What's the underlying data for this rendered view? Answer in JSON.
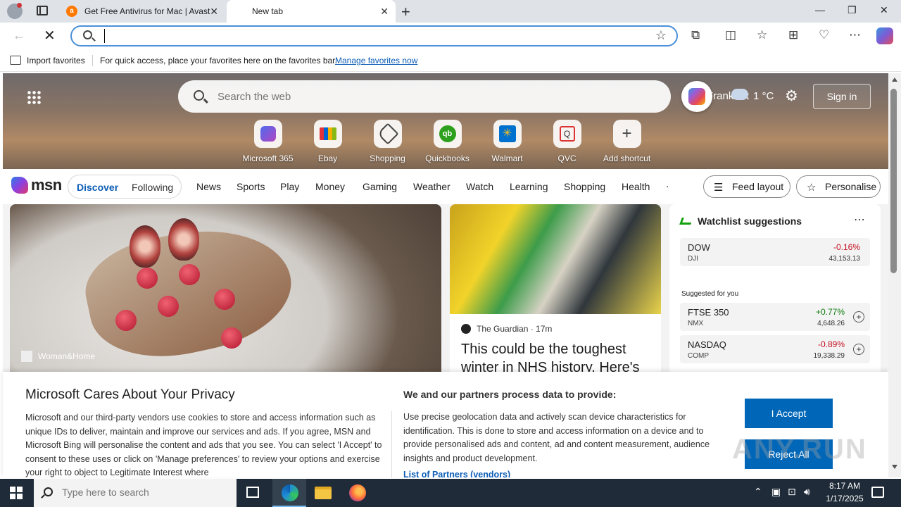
{
  "browser": {
    "tabs": [
      {
        "title": "Get Free Antivirus for Mac | Avast"
      },
      {
        "title": "New tab"
      }
    ],
    "address": {
      "value": ""
    },
    "favorites": {
      "import_label": "Import favorites",
      "message": "For quick access, place your favorites here on the favorites bar.",
      "manage_link": "Manage favorites now"
    }
  },
  "msn": {
    "search_placeholder": "Search the web",
    "location": "Frankfurt",
    "temperature": "1 °C",
    "sign_in": "Sign in",
    "shortcuts": [
      {
        "label": "Microsoft 365",
        "icon": "microsoft-365-icon"
      },
      {
        "label": "Ebay",
        "icon": "ebay-icon"
      },
      {
        "label": "Shopping",
        "icon": "shopping-tag-icon"
      },
      {
        "label": "Quickbooks",
        "icon": "quickbooks-icon"
      },
      {
        "label": "Walmart",
        "icon": "walmart-icon"
      },
      {
        "label": "QVC",
        "icon": "qvc-icon"
      },
      {
        "label": "Add shortcut",
        "icon": "plus-icon"
      }
    ],
    "logo": "msn",
    "feed_tabs": {
      "discover": "Discover",
      "following": "Following"
    },
    "categories": [
      "News",
      "Sports",
      "Play",
      "Money",
      "Gaming",
      "Weather",
      "Watch",
      "Learning",
      "Shopping",
      "Health"
    ],
    "feed_layout": "Feed layout",
    "personalise": "Personalise",
    "cards": {
      "big_source": "Woman&Home",
      "mid_source": "The Guardian · 17m",
      "mid_title": "This could be the toughest winter in NHS history. Here's"
    },
    "watchlist": {
      "title": "Watchlist suggestions",
      "suggested_label": "Suggested for you",
      "top": {
        "name": "DOW",
        "code": "DJI",
        "change": "-0.16%",
        "value": "43,153.13"
      },
      "suggested": [
        {
          "name": "FTSE 350",
          "code": "NMX",
          "change": "+0.77%",
          "value": "4,648.26"
        },
        {
          "name": "NASDAQ",
          "code": "COMP",
          "change": "-0.89%",
          "value": "19,338.29"
        }
      ]
    }
  },
  "privacy": {
    "title": "Microsoft Cares About Your Privacy",
    "body": "Microsoft and our third-party vendors use cookies to store and access information such as unique IDs to deliver, maintain and improve our services and ads. If you agree, MSN and Microsoft Bing will personalise the content and ads that you see. You can select 'I Accept' to consent to these uses or click on 'Manage preferences' to review your options and exercise your right to object to Legitimate Interest where",
    "heading2": "We and our partners process data to provide:",
    "body2": "Use precise geolocation data and actively scan device characteristics for identification. This is done to store and access information on a device and to provide personalised ads and content, ad and content measurement, audience insights and product development.",
    "partners_link": "List of Partners (vendors)",
    "accept": "I Accept",
    "reject": "Reject All"
  },
  "watermark": "ANY.RUN",
  "taskbar": {
    "search_placeholder": "Type here to search",
    "time": "8:17 AM",
    "date": "1/17/2025"
  }
}
